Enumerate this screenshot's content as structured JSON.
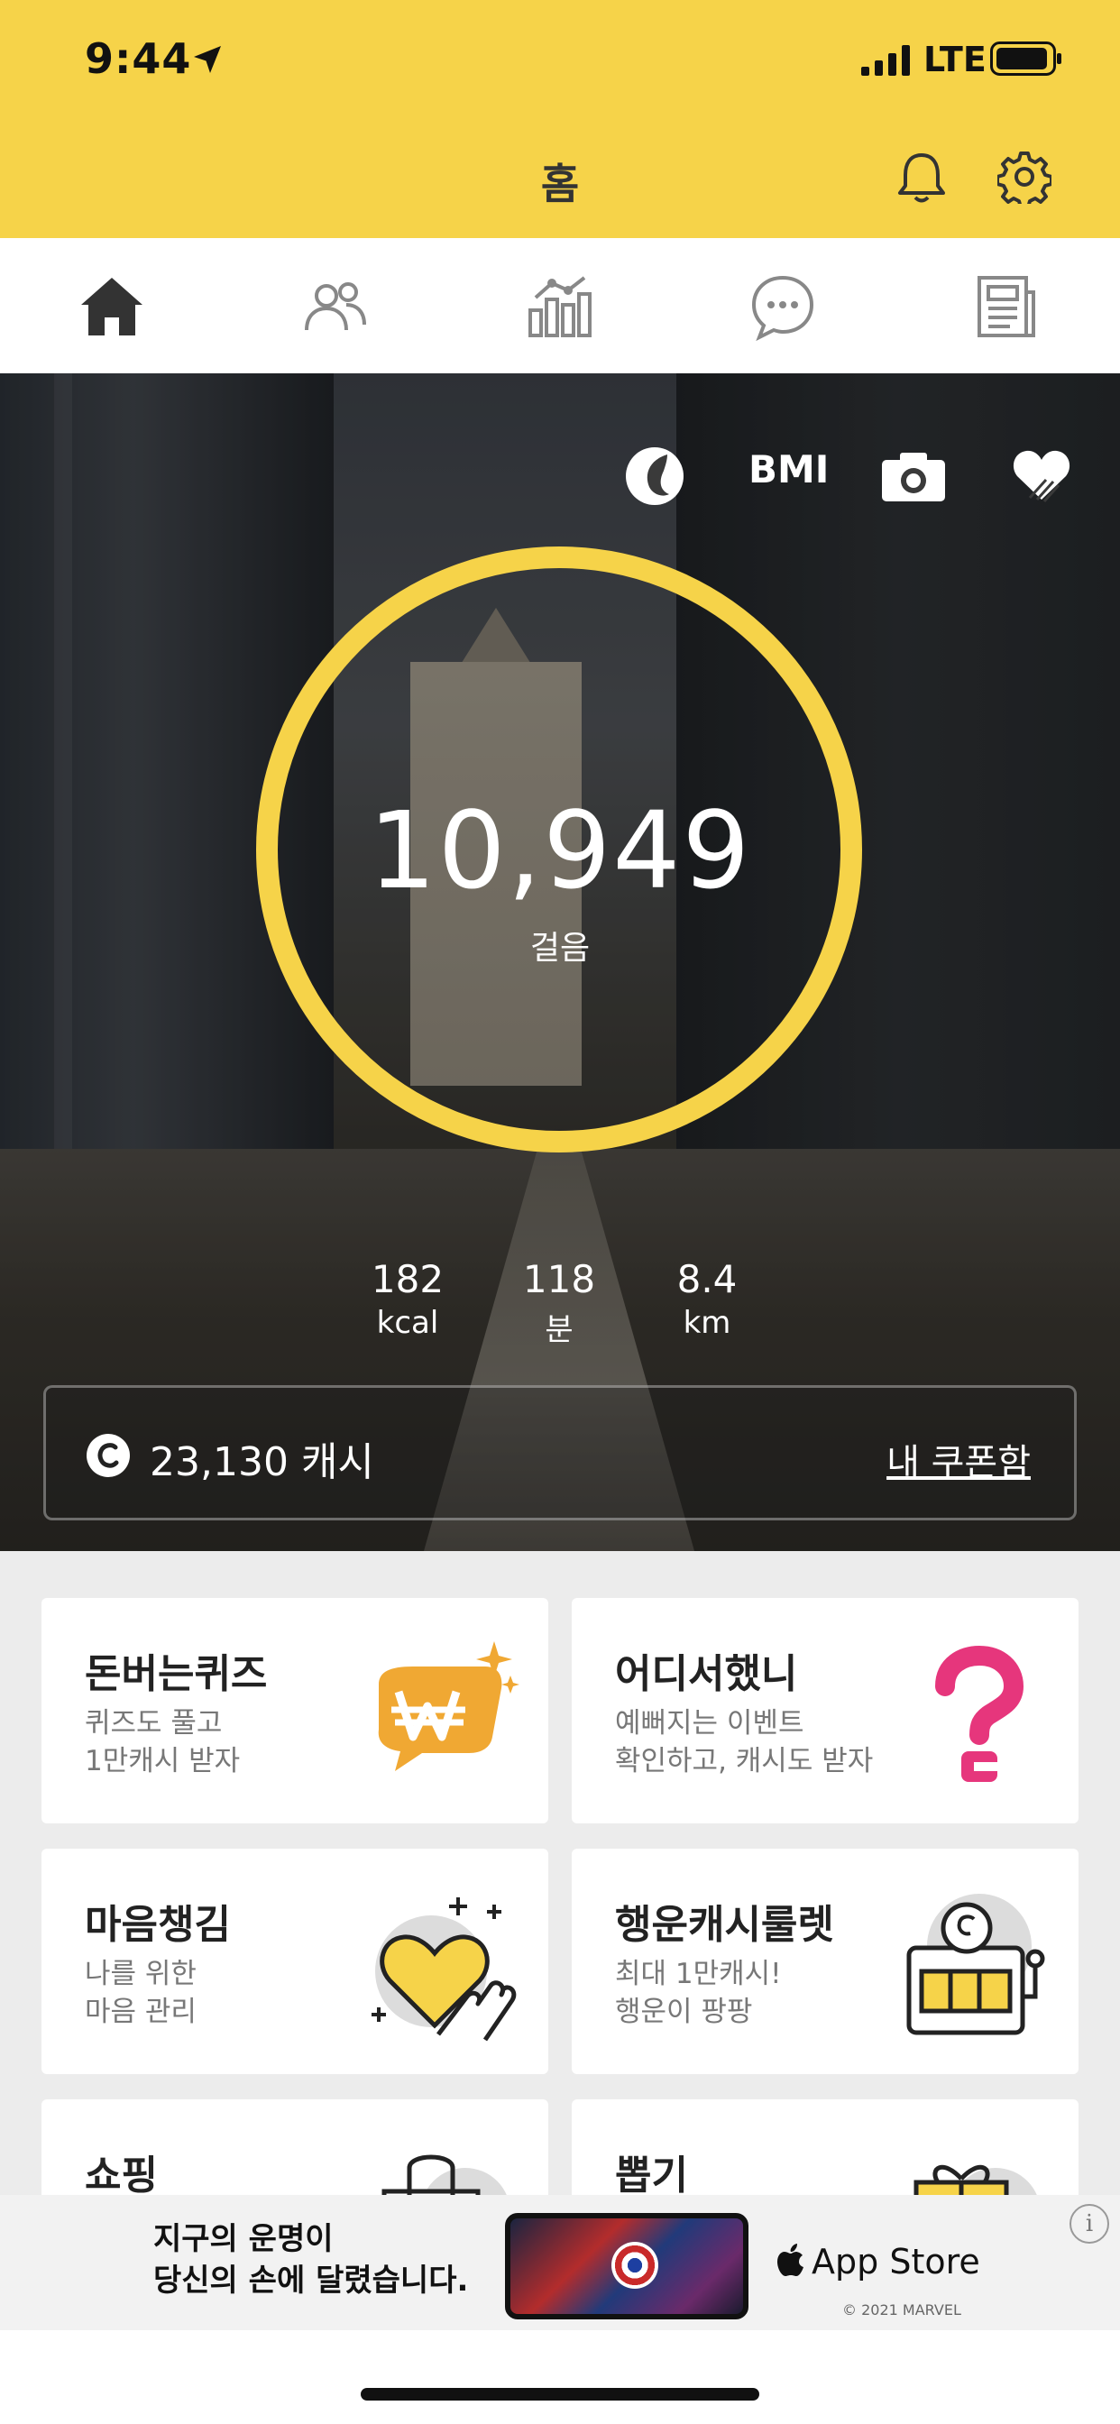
{
  "status_bar": {
    "time": "9:44",
    "network": "LTE"
  },
  "header": {
    "title": "홈"
  },
  "tabs": [
    {
      "name": "home",
      "icon": "home-icon",
      "active": true
    },
    {
      "name": "friends",
      "icon": "people-icon",
      "active": false
    },
    {
      "name": "stats",
      "icon": "chart-icon",
      "active": false
    },
    {
      "name": "chat",
      "icon": "chat-bubble-icon",
      "active": false
    },
    {
      "name": "news",
      "icon": "news-icon",
      "active": false
    }
  ],
  "hero": {
    "bmi_label": "BMI",
    "steps": "10,949",
    "steps_label": "걸음",
    "stats": [
      {
        "value": "182",
        "unit": "kcal"
      },
      {
        "value": "118",
        "unit": "분"
      },
      {
        "value": "8.4",
        "unit": "km"
      }
    ],
    "cash": "23,130 캐시",
    "coupon_link": "내 쿠폰함",
    "ring_color": "#f6d349",
    "ring_progress_percent": 100
  },
  "cards": [
    {
      "title": "돈버는퀴즈",
      "desc": [
        "퀴즈도 풀고",
        "1만캐시 받자"
      ],
      "icon": "won-sparkle-icon"
    },
    {
      "title": "어디서했니",
      "desc": [
        "예뻐지는 이벤트",
        "확인하고, 캐시도 받자"
      ],
      "icon": "question-mark-icon"
    },
    {
      "title": "마음챙김",
      "desc": [
        "나를 위한",
        "마음 관리"
      ],
      "icon": "heart-hand-icon"
    },
    {
      "title": "행운캐시룰렛",
      "desc": [
        "최대 1만캐시!",
        "행운이 팡팡"
      ],
      "icon": "slot-machine-icon"
    },
    {
      "title": "쇼핑",
      "desc": [],
      "icon": "shopping-bag-icon"
    },
    {
      "title": "뽑기",
      "desc": [],
      "icon": "gift-box-icon"
    }
  ],
  "ad": {
    "line1": "지구의 운명이",
    "line2": "당신의 손에 달렸습니다.",
    "store": "App Store",
    "copyright": "© 2021 MARVEL",
    "info": "i"
  },
  "colors": {
    "accent": "#f6d349",
    "orange": "#f0a833",
    "pink": "#e6367c"
  }
}
